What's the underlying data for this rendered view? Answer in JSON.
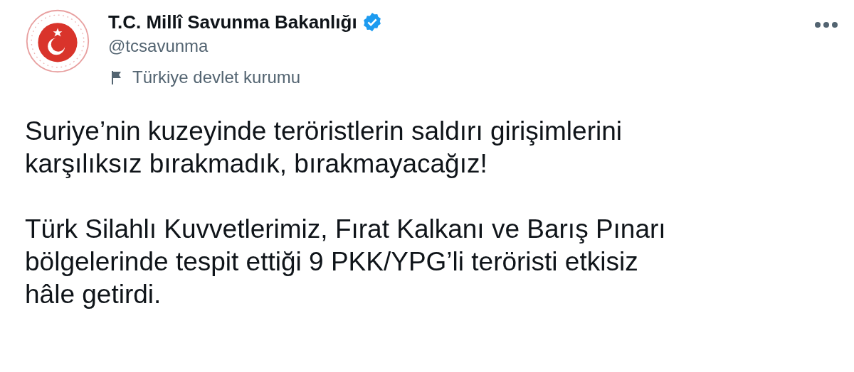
{
  "author": {
    "name": "T.C. Millî Savunma Bakanlığı",
    "verified": true,
    "handle": "@tcsavunma",
    "label": "Türkiye devlet kurumu"
  },
  "paragraphs": [
    [
      "Suriye’nin kuzeyinde teröristlerin saldırı girişimlerini",
      "karşılıksız bırakmadık, bırakmayacağız!"
    ],
    [
      "Türk Silahlı Kuvvetlerimiz, Fırat Kalkanı ve Barış Pınarı",
      "bölgelerinde tespit ettiği 9 PKK/YPG’li teröristi etkisiz",
      "hâle getirdi."
    ]
  ]
}
